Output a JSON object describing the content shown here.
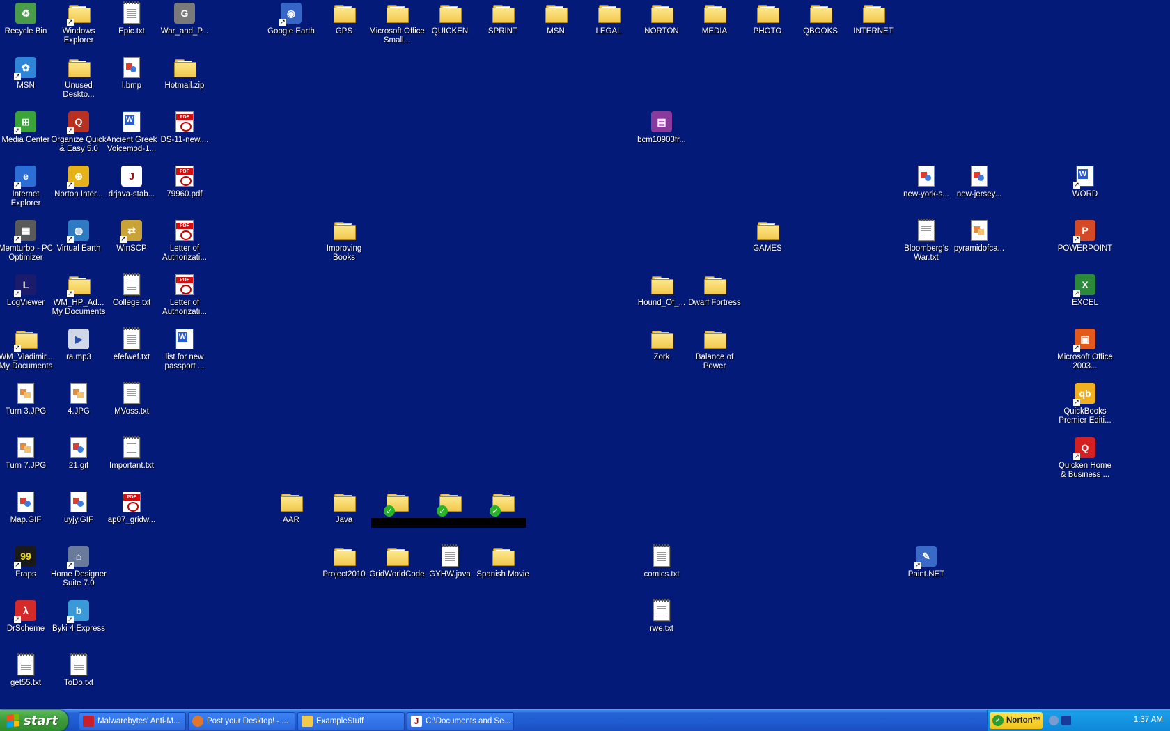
{
  "desktop": {
    "icons": [
      {
        "label": "Recycle Bin",
        "icon": "recycle-bin-icon",
        "kind": "gen",
        "color": "#4a9b4a",
        "glyph": "♻",
        "shortcut": false
      },
      {
        "label": "Windows Explorer",
        "icon": "explorer-icon",
        "kind": "folder",
        "shortcut": true
      },
      {
        "label": "Epic.txt",
        "icon": "text-file-icon",
        "kind": "doc",
        "shortcut": false
      },
      {
        "label": "War_and_P...",
        "icon": "text-file-icon",
        "kind": "gen",
        "color": "#7a7a7a",
        "glyph": "G",
        "shortcut": false
      },
      {
        "label": "Google Earth",
        "icon": "google-earth-icon",
        "kind": "gen",
        "color": "#3566c8",
        "glyph": "◉",
        "shortcut": true
      },
      {
        "label": "GPS",
        "icon": "folder-icon",
        "kind": "folder"
      },
      {
        "label": "Microsoft Office Small...",
        "icon": "folder-icon",
        "kind": "folder"
      },
      {
        "label": "QUICKEN",
        "icon": "folder-icon",
        "kind": "folder"
      },
      {
        "label": "SPRINT",
        "icon": "folder-icon",
        "kind": "folder"
      },
      {
        "label": "MSN",
        "icon": "folder-icon",
        "kind": "folder"
      },
      {
        "label": "LEGAL",
        "icon": "folder-icon",
        "kind": "folder"
      },
      {
        "label": "NORTON",
        "icon": "folder-icon",
        "kind": "folder"
      },
      {
        "label": "MEDIA",
        "icon": "folder-icon",
        "kind": "folder"
      },
      {
        "label": "PHOTO",
        "icon": "folder-icon",
        "kind": "folder"
      },
      {
        "label": "QBOOKS",
        "icon": "folder-icon",
        "kind": "folder"
      },
      {
        "label": "INTERNET",
        "icon": "folder-icon",
        "kind": "folder"
      },
      {
        "label": "MSN",
        "icon": "msn-butterfly-icon",
        "kind": "gen",
        "color": "#2f86d8",
        "glyph": "✿",
        "shortcut": true
      },
      {
        "label": "Unused Deskto...",
        "icon": "folder-icon",
        "kind": "folder"
      },
      {
        "label": "l.bmp",
        "icon": "image-file-icon",
        "kind": "img"
      },
      {
        "label": "Hotmail.zip",
        "icon": "zip-folder-icon",
        "kind": "folder"
      },
      {
        "label": "Media Center",
        "icon": "media-center-icon",
        "kind": "gen",
        "color": "#3aa33a",
        "glyph": "⊞",
        "shortcut": true
      },
      {
        "label": "Organize Quick & Easy 5.0",
        "icon": "organize-icon",
        "kind": "gen",
        "color": "#b83020",
        "glyph": "Q",
        "shortcut": true
      },
      {
        "label": "Ancient Greek Voicemod-1...",
        "icon": "word-doc-icon",
        "kind": "word"
      },
      {
        "label": "DS-11-new....",
        "icon": "pdf-file-icon",
        "kind": "pdf"
      },
      {
        "label": "bcm10903fr...",
        "icon": "winrar-icon",
        "kind": "gen",
        "color": "#8a3a9a",
        "glyph": "▤"
      },
      {
        "label": "Internet Explorer",
        "icon": "internet-explorer-icon",
        "kind": "gen",
        "color": "#2b6fd6",
        "glyph": "e",
        "shortcut": true
      },
      {
        "label": "Norton Inter...",
        "icon": "norton-icon",
        "kind": "gen",
        "color": "#e6b21b",
        "glyph": "⊕",
        "shortcut": true
      },
      {
        "label": "drjava-stab...",
        "icon": "java-icon",
        "kind": "gen",
        "color": "#ffffff",
        "glyph": "J",
        "fg": "#a01010"
      },
      {
        "label": "79960.pdf",
        "icon": "pdf-file-icon",
        "kind": "pdf"
      },
      {
        "label": "new-york-s...",
        "icon": "image-file-icon",
        "kind": "img"
      },
      {
        "label": "new-jersey...",
        "icon": "image-file-icon",
        "kind": "img"
      },
      {
        "label": "WORD",
        "icon": "word-icon",
        "kind": "word",
        "shortcut": true
      },
      {
        "label": "Memturbo - PC Optimizer",
        "icon": "memturbo-icon",
        "kind": "gen",
        "color": "#5a5a5a",
        "glyph": "▦",
        "shortcut": true
      },
      {
        "label": "Virtual Earth",
        "icon": "virtual-earth-icon",
        "kind": "gen",
        "color": "#2e7bc4",
        "glyph": "◍",
        "shortcut": true
      },
      {
        "label": "WinSCP",
        "icon": "winscp-icon",
        "kind": "gen",
        "color": "#c9a238",
        "glyph": "⇄",
        "shortcut": true
      },
      {
        "label": "Letter of Authorizati...",
        "icon": "pdf-file-icon",
        "kind": "pdf"
      },
      {
        "label": "Improving Books",
        "icon": "folder-icon",
        "kind": "folder"
      },
      {
        "label": "GAMES",
        "icon": "folder-icon",
        "kind": "folder"
      },
      {
        "label": "Bloomberg's War.txt",
        "icon": "text-file-icon",
        "kind": "doc"
      },
      {
        "label": "pyramidofca...",
        "icon": "image-file-icon",
        "kind": "jpg"
      },
      {
        "label": "POWERPOINT",
        "icon": "powerpoint-icon",
        "kind": "gen",
        "color": "#d44a26",
        "glyph": "P",
        "shortcut": true
      },
      {
        "label": "LogViewer",
        "icon": "linksys-icon",
        "kind": "gen",
        "color": "#1b1b6b",
        "glyph": "L",
        "shortcut": true
      },
      {
        "label": "WM_HP_Ad... My Documents",
        "icon": "shared-folder-icon",
        "kind": "folder",
        "shortcut": true
      },
      {
        "label": "College.txt",
        "icon": "text-file-icon",
        "kind": "doc"
      },
      {
        "label": "Letter of Authorizati...",
        "icon": "pdf-file-icon",
        "kind": "pdf"
      },
      {
        "label": "Hound_Of_...",
        "icon": "folder-icon",
        "kind": "folder"
      },
      {
        "label": "Dwarf Fortress",
        "icon": "folder-icon",
        "kind": "folder"
      },
      {
        "label": "EXCEL",
        "icon": "excel-icon",
        "kind": "gen",
        "color": "#2a8a3a",
        "glyph": "X",
        "shortcut": true
      },
      {
        "label": "WM_Vladimir... My Documents",
        "icon": "shared-folder-icon",
        "kind": "folder",
        "shortcut": true
      },
      {
        "label": "ra.mp3",
        "icon": "audio-file-icon",
        "kind": "gen",
        "color": "#d0d8e8",
        "glyph": "▶",
        "fg": "#2a4ea8"
      },
      {
        "label": "efefwef.txt",
        "icon": "text-file-icon",
        "kind": "doc"
      },
      {
        "label": "list for new passport ...",
        "icon": "word-doc-icon",
        "kind": "word"
      },
      {
        "label": "Zork",
        "icon": "folder-icon",
        "kind": "folder"
      },
      {
        "label": "Balance of Power",
        "icon": "folder-icon",
        "kind": "folder"
      },
      {
        "label": "Microsoft Office 2003...",
        "icon": "office-icon",
        "kind": "gen",
        "color": "#e45a1a",
        "glyph": "▣",
        "shortcut": true
      },
      {
        "label": "Turn 3.JPG",
        "icon": "image-file-icon",
        "kind": "jpg"
      },
      {
        "label": "4.JPG",
        "icon": "image-file-icon",
        "kind": "jpg"
      },
      {
        "label": "MVoss.txt",
        "icon": "text-file-icon",
        "kind": "doc"
      },
      {
        "label": "QuickBooks Premier Editi...",
        "icon": "quickbooks-icon",
        "kind": "gen",
        "color": "#f0b020",
        "glyph": "qb",
        "shortcut": true
      },
      {
        "label": "Turn 7.JPG",
        "icon": "image-file-icon",
        "kind": "jpg"
      },
      {
        "label": "21.gif",
        "icon": "image-file-icon",
        "kind": "img"
      },
      {
        "label": "Important.txt",
        "icon": "text-file-icon",
        "kind": "doc"
      },
      {
        "label": "Quicken Home & Business ...",
        "icon": "quicken-icon",
        "kind": "gen",
        "color": "#d42020",
        "glyph": "Q",
        "shortcut": true
      },
      {
        "label": "Map.GIF",
        "icon": "image-file-icon",
        "kind": "img"
      },
      {
        "label": "uyjy.GIF",
        "icon": "image-file-icon",
        "kind": "img"
      },
      {
        "label": "ap07_gridw...",
        "icon": "pdf-file-icon",
        "kind": "pdf"
      },
      {
        "label": "AAR",
        "icon": "folder-icon",
        "kind": "folder"
      },
      {
        "label": "Java",
        "icon": "folder-icon",
        "kind": "folder"
      },
      {
        "label": "",
        "icon": "synced-folder-icon",
        "kind": "folder",
        "check": true
      },
      {
        "label": "",
        "icon": "synced-folder-icon",
        "kind": "folder",
        "check": true
      },
      {
        "label": "",
        "icon": "synced-folder-icon",
        "kind": "folder",
        "check": true
      },
      {
        "label": "Fraps",
        "icon": "fraps-icon",
        "kind": "gen",
        "color": "#1a1a1a",
        "glyph": "99",
        "fg": "#f4e000",
        "shortcut": true
      },
      {
        "label": "Home Designer Suite 7.0",
        "icon": "home-designer-icon",
        "kind": "gen",
        "color": "#6a7a9a",
        "glyph": "⌂",
        "shortcut": true
      },
      {
        "label": "Project2010",
        "icon": "folder-icon",
        "kind": "folder"
      },
      {
        "label": "GridWorldCode",
        "icon": "folder-icon",
        "kind": "folder"
      },
      {
        "label": "GYHW.java",
        "icon": "text-file-icon",
        "kind": "doc"
      },
      {
        "label": "Spanish Movie",
        "icon": "folder-icon",
        "kind": "folder"
      },
      {
        "label": "comics.txt",
        "icon": "text-file-icon",
        "kind": "doc"
      },
      {
        "label": "Paint.NET",
        "icon": "paintnet-icon",
        "kind": "gen",
        "color": "#3a6ac8",
        "glyph": "✎",
        "shortcut": true
      },
      {
        "label": "DrScheme",
        "icon": "drscheme-icon",
        "kind": "gen",
        "color": "#d42a2a",
        "glyph": "λ",
        "shortcut": true
      },
      {
        "label": "Byki 4 Express",
        "icon": "byki-icon",
        "kind": "gen",
        "color": "#3a9ad8",
        "glyph": "b",
        "shortcut": true
      },
      {
        "label": "rwe.txt",
        "icon": "text-file-icon",
        "kind": "doc"
      },
      {
        "label": "get55.txt",
        "icon": "text-file-icon",
        "kind": "doc"
      },
      {
        "label": "ToDo.txt",
        "icon": "text-file-icon",
        "kind": "doc"
      }
    ]
  },
  "taskbar": {
    "start_label": "start",
    "tasks": [
      {
        "label": "Malwarebytes' Anti-M...",
        "icon": "malwarebytes-icon",
        "color": "#c8202a"
      },
      {
        "label": "Post your Desktop! - ...",
        "icon": "firefox-icon",
        "color": "#e0772a"
      },
      {
        "label": "ExampleStuff",
        "icon": "folder-icon",
        "color": "#f2c94d"
      },
      {
        "label": "C:\\Documents and Se...",
        "icon": "java-icon",
        "color": "#ffffff"
      }
    ],
    "tray": {
      "norton_label": "Norton™",
      "clock": "1:37 AM"
    }
  }
}
